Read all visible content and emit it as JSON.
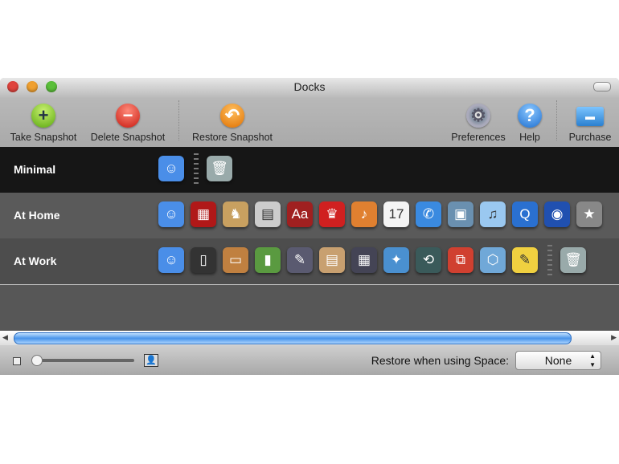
{
  "window": {
    "title": "Docks"
  },
  "toolbar": {
    "take_snapshot": "Take Snapshot",
    "delete_snapshot": "Delete Snapshot",
    "restore_snapshot": "Restore Snapshot",
    "preferences": "Preferences",
    "help": "Help",
    "purchase": "Purchase",
    "help_glyph": "?"
  },
  "rows": [
    {
      "label": "Minimal",
      "icons": [
        "finder",
        "trash"
      ]
    },
    {
      "label": "At Home",
      "icons": [
        "finder",
        "photo-booth",
        "chess",
        "dvd-player",
        "dictionary",
        "front-row",
        "garageband",
        "ical",
        "ichat",
        "iphoto",
        "itunes",
        "quicktime",
        "dvd-player-disc",
        "imovie"
      ]
    },
    {
      "label": "At Work",
      "icons": [
        "finder",
        "iphone-config",
        "keynote",
        "numbers",
        "script-editor",
        "preview",
        "spaces",
        "safari",
        "time-machine",
        "vmware-fusion",
        "virtualbox",
        "stickies",
        "trash"
      ]
    }
  ],
  "footer": {
    "restore_label": "Restore when using Space:",
    "space_value": "None"
  },
  "colors": {
    "accent": "#4a94ea"
  }
}
